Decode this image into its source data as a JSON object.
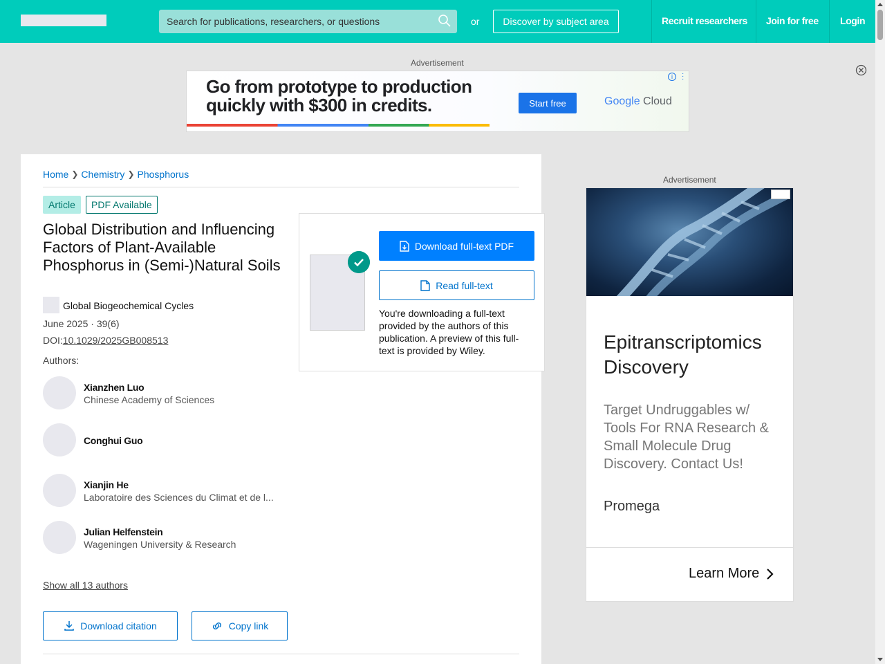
{
  "header": {
    "search_placeholder": "Search for publications, researchers, or questions",
    "or_text": "or",
    "discover_label": "Discover by subject area",
    "nav": [
      "Recruit researchers",
      "Join for free",
      "Login"
    ],
    "brand_color": "#00ccbb"
  },
  "banner_ad": {
    "label": "Advertisement",
    "headline": "Go from prototype to production quickly with $300 in credits.",
    "button": "Start free",
    "brand_google": "Google",
    "brand_cloud": "Cloud"
  },
  "breadcrumb": [
    "Home",
    "Chemistry",
    "Phosphorus"
  ],
  "article": {
    "type": "Article",
    "pdf_badge": "PDF Available",
    "title": "Global Distribution and Influencing Factors of Plant-Available Phosphorus in (Semi-)Natural Soils",
    "journal": "Global Biogeochemical Cycles",
    "date": "June 2025 · 39(6)",
    "doi_prefix": "DOI:",
    "doi": "10.1029/2025GB008513",
    "authors_label": "Authors:",
    "authors": [
      {
        "name": "Xianzhen Luo",
        "affiliation": "Chinese Academy of Sciences"
      },
      {
        "name": "Conghui Guo",
        "affiliation": ""
      },
      {
        "name": "Xianjin He",
        "affiliation": "Laboratoire des Sciences du Climat et de l..."
      },
      {
        "name": "Julian Helfenstein",
        "affiliation": "Wageningen University & Research"
      }
    ],
    "show_all": "Show all 13 authors",
    "download_citation": "Download citation",
    "copy_link": "Copy link"
  },
  "download_panel": {
    "download_pdf": "Download full-text PDF",
    "read_fulltext": "Read full-text",
    "note": "You're downloading a full-text provided by the authors of this publication. A preview of this full-text is provided by Wiley."
  },
  "side_ad": {
    "label": "Advertisement",
    "title": "Epitranscriptomics Discovery",
    "body": "Target Undruggables w/ Tools For RNA Research & Small Molecule Drug Discovery. Contact Us!",
    "brand": "Promega",
    "cta": "Learn More"
  }
}
